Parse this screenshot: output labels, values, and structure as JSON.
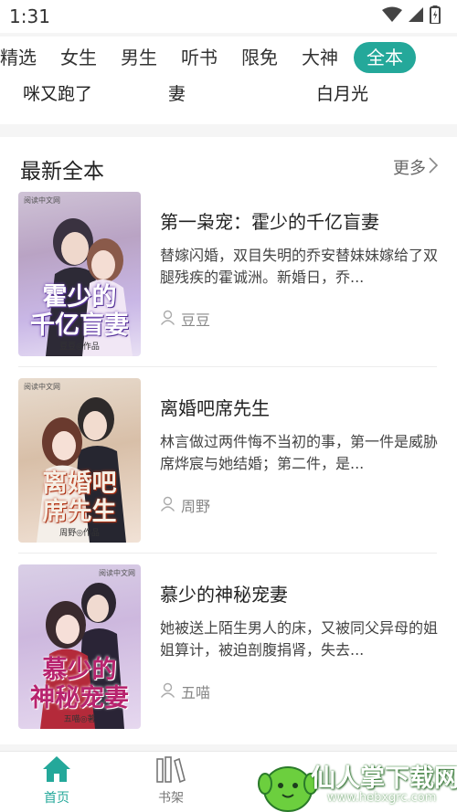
{
  "status_bar": {
    "time": "1:31"
  },
  "category_tabs": [
    "精选",
    "女生",
    "男生",
    "听书",
    "限免",
    "大神",
    "全本"
  ],
  "previous_row_titles": [
    "咪又跑了",
    "妻",
    "白月光"
  ],
  "section": {
    "title": "最新全本",
    "more_label": "更多"
  },
  "books": [
    {
      "title": "第一枭宠：霍少的千亿盲妻",
      "description": "替嫁闪婚，双目失明的乔安替妹妹嫁给了双腿残疾的霍诚洲。新婚日，乔...",
      "author": "豆豆",
      "cover": {
        "publisher": "阅读中文网",
        "title_lines": [
          "霍少的",
          "千亿盲妻"
        ],
        "author_line": "豆豆◎作品"
      }
    },
    {
      "title": "离婚吧席先生",
      "description": "林言做过两件悔不当初的事，第一件是威胁席烨宸与她结婚；第二件，是...",
      "author": "周野",
      "cover": {
        "publisher": "阅读中文网",
        "title_lines": [
          "离婚吧",
          "席先生"
        ],
        "author_line": "周野◎作品"
      }
    },
    {
      "title": "慕少的神秘宠妻",
      "description": "她被送上陌生男人的床，又被同父异母的姐姐算计，被迫剖腹捐肾，失去...",
      "author": "五喵",
      "cover": {
        "publisher": "阅读中文网",
        "title_lines": [
          "慕少的",
          "神秘宠妻"
        ],
        "author_line": "五喵◎著"
      }
    }
  ],
  "bottom_nav": [
    {
      "label": "首页",
      "icon": "home-icon",
      "active": true
    },
    {
      "label": "书架",
      "icon": "bookshelf-icon",
      "active": false
    }
  ],
  "watermark": {
    "text": "仙人掌下载网",
    "url": "www.hebxgrc.com"
  },
  "colors": {
    "accent": "#24a89a"
  }
}
